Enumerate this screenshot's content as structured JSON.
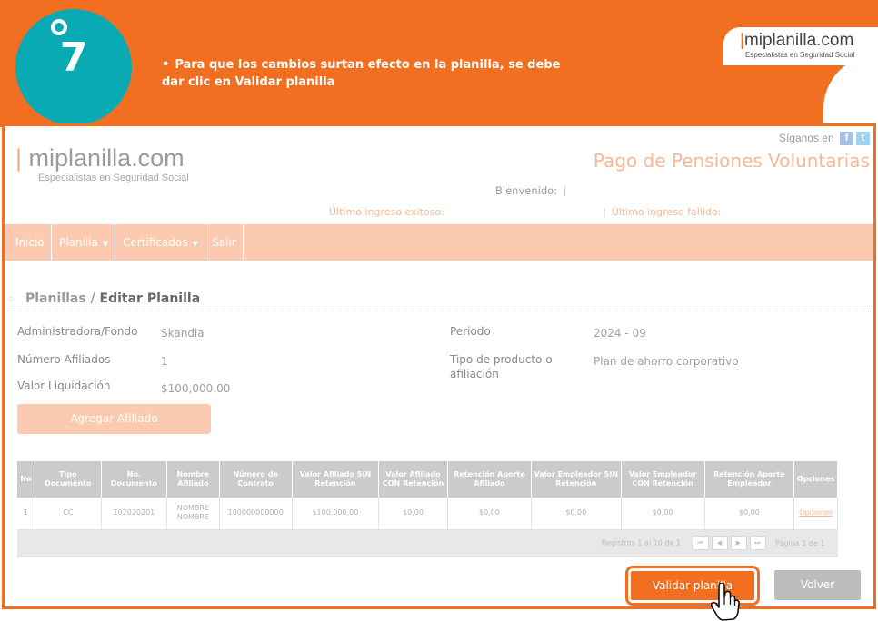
{
  "banner": {
    "step_number": "7",
    "bullet": "•",
    "text_plain": "Para que los cambios surtan efecto en la planilla, se debe dar clic en ",
    "text_bold": "Validar planilla",
    "logo_main": "miplanilla.com",
    "logo_bar": "|",
    "logo_sub": "Especialistas en Seguridad Social",
    "brand_color": "#f26f21",
    "step_color": "#0aaab4"
  },
  "app": {
    "logo_bar": "|",
    "logo_main": "miplanilla.com",
    "logo_sub": "Especialistas en Seguridad Social",
    "follow_label": "Síganos en",
    "facebook_icon": "f",
    "twitter_icon": "t",
    "page_title": "Pago de Pensiones Voluntarias",
    "welcome_label": "Bienvenido:",
    "last_success_label": "Último ingreso exitoso:",
    "last_fail_sep": "|",
    "last_fail_label": "Último ingreso fallido:"
  },
  "nav": {
    "items": [
      {
        "label": "Inicio",
        "has_caret": false
      },
      {
        "label": "Planilla",
        "has_caret": true
      },
      {
        "label": "Certificados",
        "has_caret": true
      },
      {
        "label": "Salir",
        "has_caret": false
      }
    ],
    "caret": "▼"
  },
  "breadcrumb": {
    "parent": "Planillas",
    "separator": "/",
    "current": "Editar Planilla"
  },
  "form": {
    "admin_label": "Administradora/Fondo",
    "admin_value": "Skandia",
    "affiliates_label": "Número Afiliados",
    "affiliates_value": "1",
    "liquidation_label": "Valor Liquidación",
    "liquidation_value": "$100,000.00",
    "period_label": "Periodo",
    "period_value": "2024 - 09",
    "product_label": "Tipo de producto o afiliación",
    "product_value": "Plan de ahorro corporativo",
    "add_button": "Agregar Afiliado"
  },
  "table": {
    "headers": [
      "No",
      "Tipo Documento",
      "No. Documento",
      "Nombre Afiliado",
      "Número de Contrato",
      "Valor Afiliado SIN Retención",
      "Valor Afiliado CON Retención",
      "Retención Aporte Afiliado",
      "Valor Empleador SIN Retención",
      "Valor Empleador CON Retención",
      "Retención Aporte Empleador",
      "Opciones"
    ],
    "rows": [
      [
        "1",
        "CC",
        "102020201",
        "NOMBRE NOMBRE",
        "100000000000",
        "$100.000,00",
        "$0,00",
        "$0,00",
        "$0,00",
        "$0,00",
        "$0,00",
        "Opciones"
      ]
    ],
    "records_text": "Registros 1 al 10 de 1",
    "pager": [
      "⏮",
      "◀",
      "▶",
      "⏭"
    ],
    "page_text": "Página 1 de 1"
  },
  "actions": {
    "validate": "Validar planilla",
    "back": "Volver"
  }
}
